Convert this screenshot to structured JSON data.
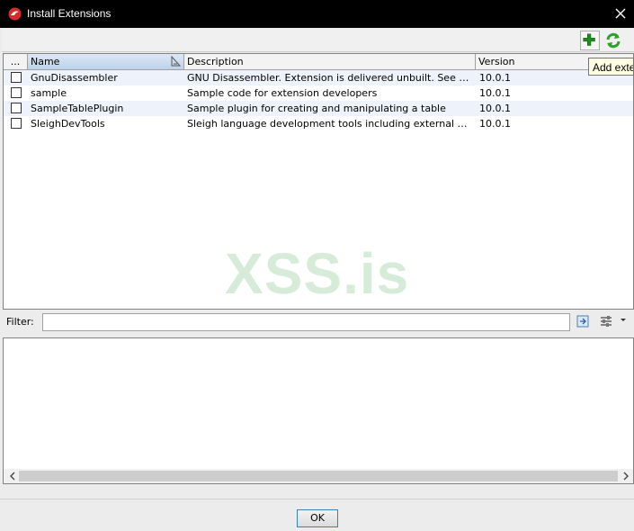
{
  "window": {
    "title": "Install Extensions"
  },
  "toolbar": {
    "tooltip": "Add extension"
  },
  "table": {
    "columns": [
      "...",
      "Name",
      "Description",
      "Version"
    ],
    "rows": [
      {
        "checked": false,
        "name": "GnuDisassembler",
        "description": "GNU Disassembler.  Extension is delivered unbuilt.  See module...",
        "version": "10.0.1"
      },
      {
        "checked": false,
        "name": "sample",
        "description": "Sample code for extension developers",
        "version": "10.0.1"
      },
      {
        "checked": false,
        "name": "SampleTablePlugin",
        "description": "Sample plugin for creating and manipulating a table",
        "version": "10.0.1"
      },
      {
        "checked": false,
        "name": "SleighDevTools",
        "description": "Sleigh language development tools including external disassem...",
        "version": "10.0.1"
      }
    ]
  },
  "watermark": "XSS.is",
  "filter": {
    "label": "Filter:",
    "value": ""
  },
  "footer": {
    "ok_label": "OK"
  },
  "colors": {
    "titlebar": "#000000",
    "accent_green": "#2e8b2e",
    "selected_header": "#bcd2ec",
    "watermark": "#d6ecd9"
  }
}
